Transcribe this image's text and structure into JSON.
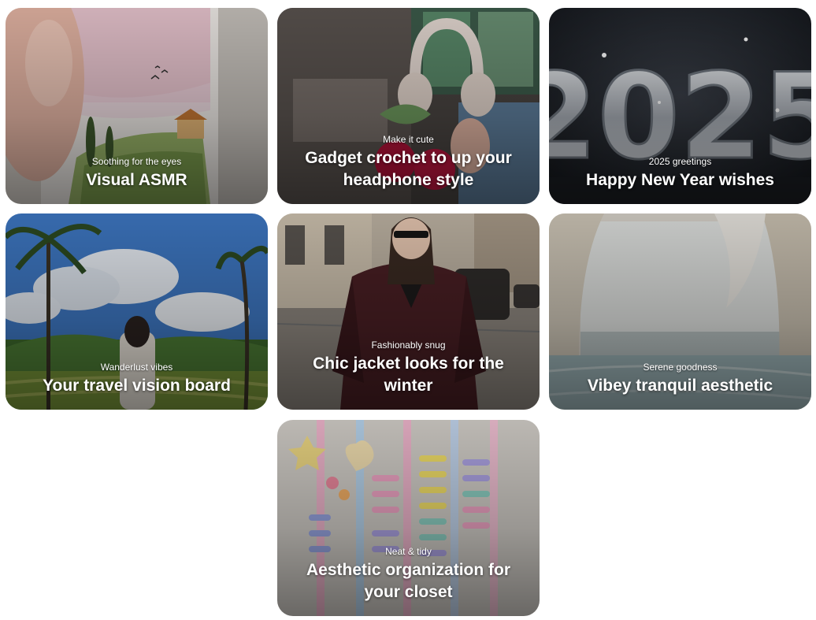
{
  "cards": [
    {
      "subtitle": "Soothing for the eyes",
      "title": "Visual ASMR"
    },
    {
      "subtitle": "Make it cute",
      "title": "Gadget crochet to up your headphone style"
    },
    {
      "subtitle": "2025 greetings",
      "title": "Happy New Year wishes"
    },
    {
      "subtitle": "Wanderlust vibes",
      "title": "Your travel vision board"
    },
    {
      "subtitle": "Fashionably snug",
      "title": "Chic jacket looks for the winter"
    },
    {
      "subtitle": "Serene goodness",
      "title": "Vibey tranquil aesthetic"
    },
    {
      "subtitle": "Neat & tidy",
      "title": "Aesthetic organization for your closet"
    }
  ],
  "images": [
    {
      "icon": "watercolor-painting-image"
    },
    {
      "icon": "crochet-headphones-image"
    },
    {
      "icon": "glitter-2025-image",
      "text": "2025"
    },
    {
      "icon": "tropical-palm-trees-image"
    },
    {
      "icon": "leather-jacket-street-image"
    },
    {
      "icon": "serene-water-arch-image"
    },
    {
      "icon": "hair-clips-organizer-image"
    }
  ]
}
